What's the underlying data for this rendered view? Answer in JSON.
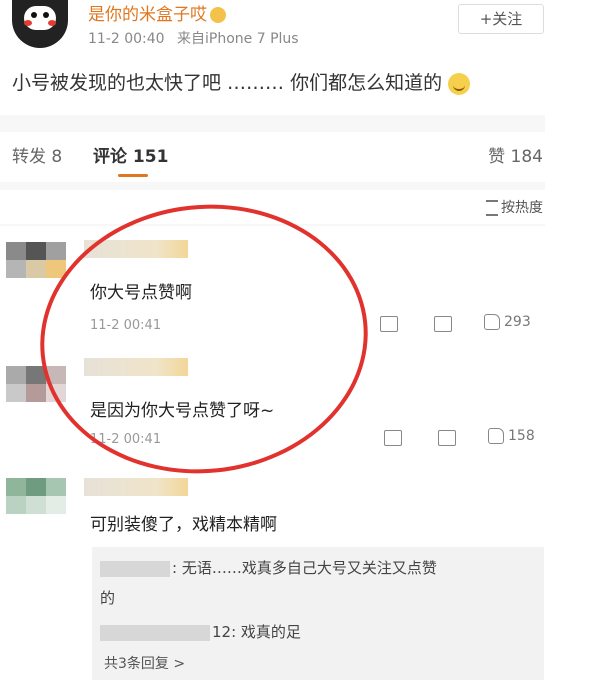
{
  "post": {
    "username": "是你的米盒子哎",
    "time": "11-2 00:40",
    "source": "来自iPhone 7 Plus",
    "follow_label": "+关注",
    "text": "小号被发现的也太快了吧 ……… 你们都怎么知道的"
  },
  "tabs": {
    "repost": "转发 8",
    "comment": "评论 151",
    "like": "赞 184"
  },
  "sort_label": "按热度",
  "comments": [
    {
      "text": "你大号点赞啊",
      "time": "11-2 00:41",
      "likes": "293"
    },
    {
      "text": "是因为你大号点赞了呀~",
      "time": "11-2 00:41",
      "likes": "158"
    },
    {
      "text": "可别装傻了，戏精本精啊"
    }
  ],
  "replies": {
    "r1a": ": 无语……戏真多自己大号又关注又点赞",
    "r1b": "的",
    "r2": "12: 戏真的足",
    "more": "共3条回复 >"
  },
  "colors": {
    "accent": "#e0771f",
    "circle": "#e1322d"
  }
}
